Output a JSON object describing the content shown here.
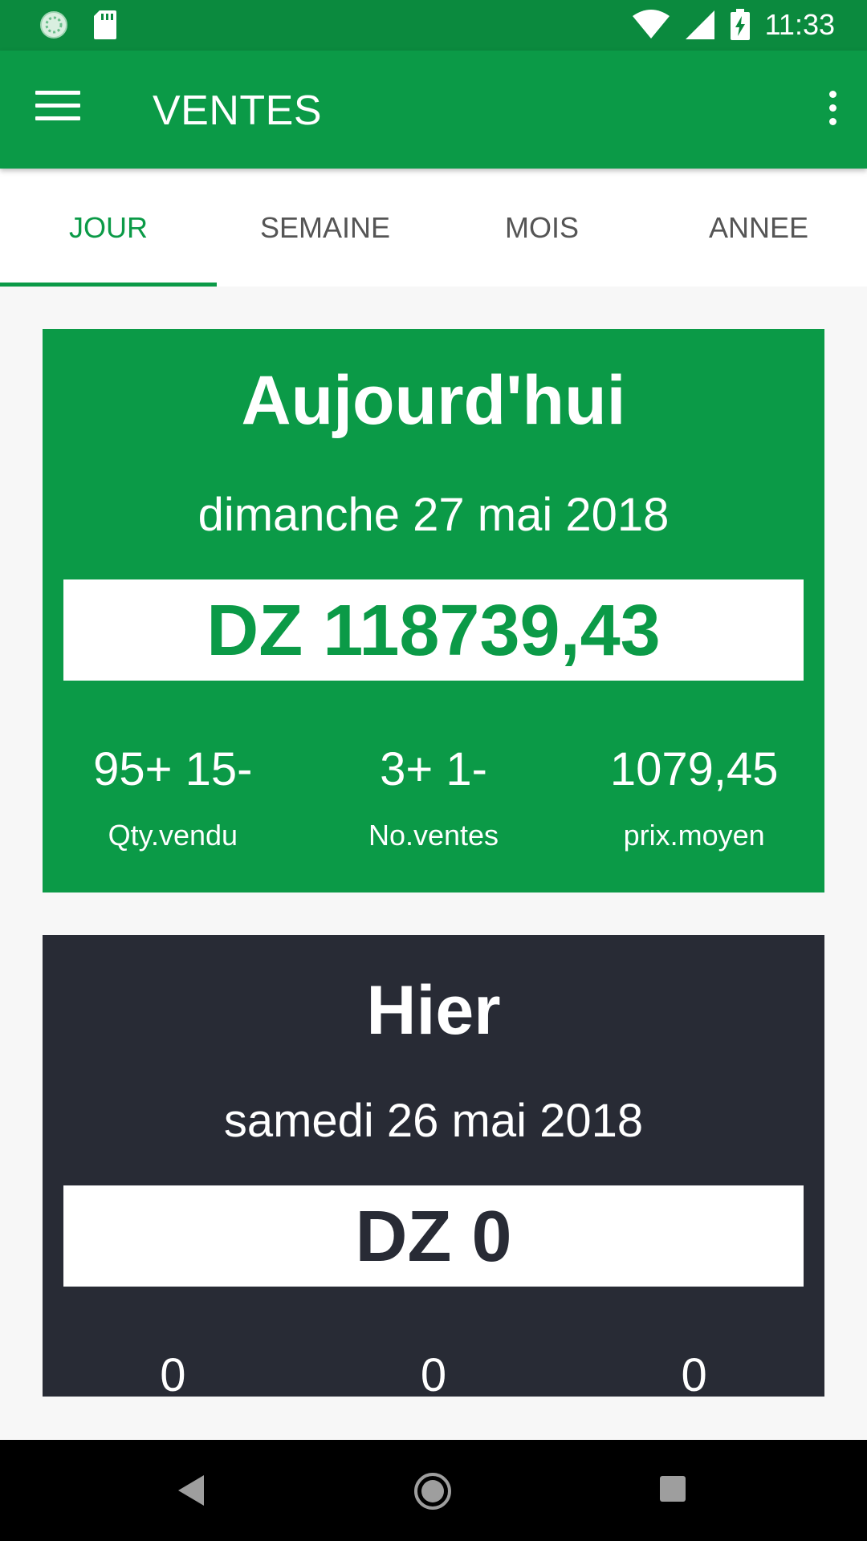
{
  "status_bar": {
    "time": "11:33"
  },
  "app_bar": {
    "title": "VENTES"
  },
  "tabs": [
    {
      "label": "JOUR",
      "active": true
    },
    {
      "label": "SEMAINE",
      "active": false
    },
    {
      "label": "MOIS",
      "active": false
    },
    {
      "label": "ANNEE",
      "active": false
    }
  ],
  "today": {
    "title": "Aujourd'hui",
    "date": "dimanche 27 mai 2018",
    "amount": "DZ 118739,43",
    "stats": [
      {
        "value": "95+ 15-",
        "label": "Qty.vendu"
      },
      {
        "value": "3+ 1-",
        "label": "No.ventes"
      },
      {
        "value": "1079,45",
        "label": "prix.moyen"
      }
    ]
  },
  "yesterday": {
    "title": "Hier",
    "date": "samedi 26 mai 2018",
    "amount": "DZ 0",
    "stats": [
      {
        "value": "0"
      },
      {
        "value": "0"
      },
      {
        "value": "0"
      }
    ]
  },
  "colors": {
    "primary": "#0b9a47",
    "status_bar": "#0b8a3e",
    "dark_card": "#282b35"
  },
  "icons": {
    "status_left": [
      "sync-icon",
      "sd-card-icon"
    ],
    "status_right": [
      "wifi-icon",
      "signal-icon",
      "battery-charging-icon"
    ]
  }
}
